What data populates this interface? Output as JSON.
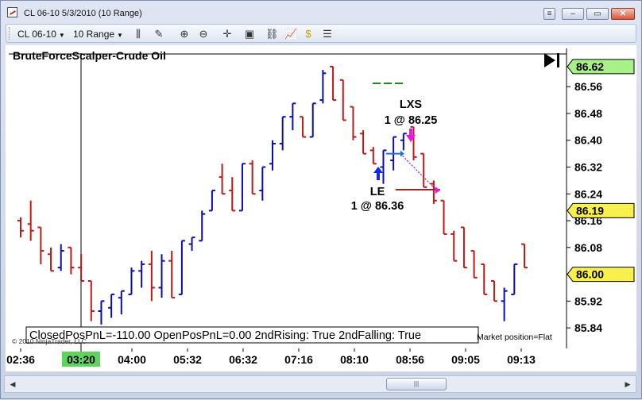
{
  "window": {
    "title": "CL 06-10  5/3/2010 (10 Range)",
    "minimize": "–",
    "restore": "▭",
    "maximize": "□",
    "close": "✕",
    "small_btn": "≡"
  },
  "toolbar": {
    "instrument": "CL 06-10",
    "interval": "10 Range"
  },
  "chart": {
    "title": "BruteForceScalper-Crude Oil",
    "status_line": "ClosedPosPnL=-110.00 OpenPosPnL=0.00 2ndRising: True 2ndFalling: True",
    "copyright": "© 2010 NinjaTrader, LLC",
    "market_position": "Market position=Flat",
    "last_price_tag": "86.62",
    "marker_tag_1": "86.19",
    "marker_tag_2": "86.00",
    "colors": {
      "up": "#0c0cb0",
      "down": "#c01818",
      "last_tag": "#a8f088",
      "marker_tag": "#f8f04c",
      "entry_arrow": "#1028e8",
      "exit_arrow": "#e818e0"
    }
  },
  "chart_data": {
    "type": "ohlc",
    "title": "BruteForceScalper-Crude Oil",
    "ylim": [
      85.8,
      86.66
    ],
    "y_ticks": [
      "86.56",
      "86.48",
      "86.40",
      "86.32",
      "86.24",
      "86.16",
      "86.08",
      "86.00",
      "85.92",
      "85.84"
    ],
    "x_ticks": [
      "02:36",
      "03:20",
      "04:00",
      "05:32",
      "06:32",
      "07:16",
      "08:10",
      "08:56",
      "09:05",
      "09:13"
    ],
    "highlighted_x_tick": "03:20",
    "bars": [
      {
        "o": 86.16,
        "h": 86.17,
        "l": 86.11,
        "c": 86.13
      },
      {
        "o": 86.15,
        "h": 86.22,
        "l": 86.1,
        "c": 86.13
      },
      {
        "o": 86.14,
        "h": 86.14,
        "l": 86.03,
        "c": 86.07
      },
      {
        "o": 86.06,
        "h": 86.08,
        "l": 86.01,
        "c": 86.01
      },
      {
        "o": 86.02,
        "h": 86.09,
        "l": 86.01,
        "c": 86.07
      },
      {
        "o": 86.08,
        "h": 86.08,
        "l": 86.0,
        "c": 86.02
      },
      {
        "o": 86.02,
        "h": 86.06,
        "l": 85.98,
        "c": 85.98
      },
      {
        "o": 85.98,
        "h": 85.98,
        "l": 85.86,
        "c": 85.89
      },
      {
        "o": 85.89,
        "h": 85.92,
        "l": 85.85,
        "c": 85.92
      },
      {
        "o": 85.9,
        "h": 85.94,
        "l": 85.87,
        "c": 85.94
      },
      {
        "o": 85.93,
        "h": 85.95,
        "l": 85.88,
        "c": 85.95
      },
      {
        "o": 85.94,
        "h": 86.02,
        "l": 85.94,
        "c": 86.01
      },
      {
        "o": 86.01,
        "h": 86.04,
        "l": 85.96,
        "c": 86.03
      },
      {
        "o": 86.03,
        "h": 86.07,
        "l": 85.92,
        "c": 85.96
      },
      {
        "o": 85.96,
        "h": 86.06,
        "l": 85.93,
        "c": 86.04
      },
      {
        "o": 86.04,
        "h": 86.07,
        "l": 85.93,
        "c": 85.93
      },
      {
        "o": 85.94,
        "h": 86.1,
        "l": 85.94,
        "c": 86.1
      },
      {
        "o": 86.09,
        "h": 86.11,
        "l": 86.07,
        "c": 86.11
      },
      {
        "o": 86.1,
        "h": 86.19,
        "l": 86.1,
        "c": 86.18
      },
      {
        "o": 86.19,
        "h": 86.25,
        "l": 86.19,
        "c": 86.25
      },
      {
        "o": 86.29,
        "h": 86.33,
        "l": 86.24,
        "c": 86.24
      },
      {
        "o": 86.25,
        "h": 86.29,
        "l": 86.19,
        "c": 86.19
      },
      {
        "o": 86.19,
        "h": 86.33,
        "l": 86.19,
        "c": 86.33
      },
      {
        "o": 86.33,
        "h": 86.34,
        "l": 86.24,
        "c": 86.24
      },
      {
        "o": 86.25,
        "h": 86.32,
        "l": 86.22,
        "c": 86.32
      },
      {
        "o": 86.33,
        "h": 86.4,
        "l": 86.31,
        "c": 86.39
      },
      {
        "o": 86.39,
        "h": 86.47,
        "l": 86.37,
        "c": 86.47
      },
      {
        "o": 86.47,
        "h": 86.51,
        "l": 86.43,
        "c": 86.51
      },
      {
        "o": 86.47,
        "h": 86.47,
        "l": 86.41,
        "c": 86.41
      },
      {
        "o": 86.41,
        "h": 86.51,
        "l": 86.41,
        "c": 86.51
      },
      {
        "o": 86.52,
        "h": 86.61,
        "l": 86.51,
        "c": 86.6
      },
      {
        "o": 86.62,
        "h": 86.62,
        "l": 86.52,
        "c": 86.52
      },
      {
        "o": 86.58,
        "h": 86.58,
        "l": 86.46,
        "c": 86.46
      },
      {
        "o": 86.5,
        "h": 86.5,
        "l": 86.4,
        "c": 86.41
      },
      {
        "o": 86.42,
        "h": 86.43,
        "l": 86.36,
        "c": 86.36
      },
      {
        "o": 86.37,
        "h": 86.38,
        "l": 86.33,
        "c": 86.33
      },
      {
        "o": 86.32,
        "h": 86.37,
        "l": 86.27,
        "c": 86.37
      },
      {
        "o": 86.34,
        "h": 86.41,
        "l": 86.31,
        "c": 86.41
      },
      {
        "o": 86.4,
        "h": 86.42,
        "l": 86.37,
        "c": 86.42
      },
      {
        "o": 86.44,
        "h": 86.44,
        "l": 86.34,
        "c": 86.35
      },
      {
        "o": 86.36,
        "h": 86.36,
        "l": 86.26,
        "c": 86.26
      },
      {
        "o": 86.27,
        "h": 86.28,
        "l": 86.21,
        "c": 86.22
      },
      {
        "o": 86.22,
        "h": 86.22,
        "l": 86.12,
        "c": 86.12
      },
      {
        "o": 86.12,
        "h": 86.13,
        "l": 86.04,
        "c": 86.04
      },
      {
        "o": 86.14,
        "h": 86.14,
        "l": 86.02,
        "c": 86.02
      },
      {
        "o": 86.07,
        "h": 86.07,
        "l": 85.99,
        "c": 85.99
      },
      {
        "o": 86.03,
        "h": 86.03,
        "l": 85.94,
        "c": 85.94
      },
      {
        "o": 85.98,
        "h": 85.98,
        "l": 85.92,
        "c": 85.92
      },
      {
        "o": 85.92,
        "h": 85.96,
        "l": 85.86,
        "c": 85.95
      },
      {
        "o": 85.94,
        "h": 86.03,
        "l": 85.94,
        "c": 86.03
      },
      {
        "o": 86.09,
        "h": 86.09,
        "l": 86.02,
        "c": 86.02
      }
    ],
    "trades": [
      {
        "label": "LE",
        "detail": "1 @ 86.36",
        "price": 86.36,
        "bar": 38,
        "direction": "long-entry"
      },
      {
        "label": "LXS",
        "detail": "1 @ 86.25",
        "price": 86.25,
        "bar": 41,
        "direction": "long-exit"
      }
    ],
    "green_dash_level": 86.57,
    "grid": false
  }
}
